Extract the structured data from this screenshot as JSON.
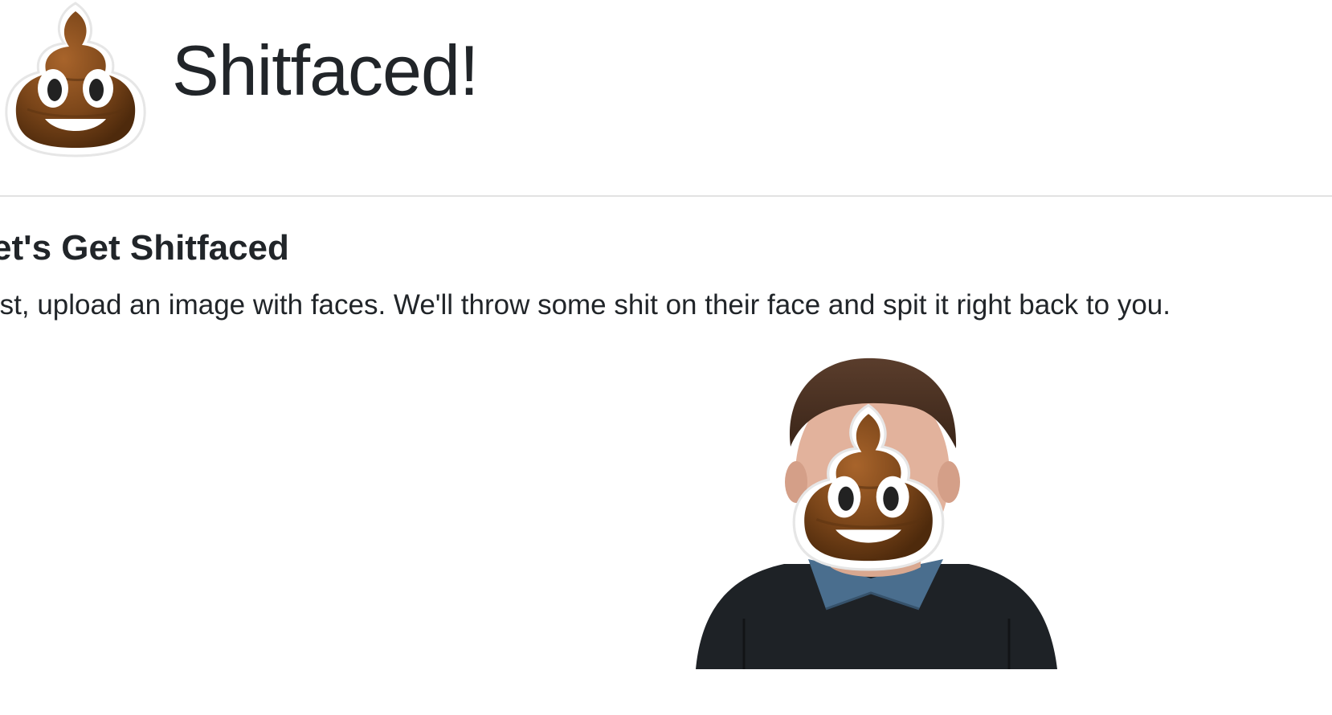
{
  "header": {
    "logo_icon": "pile-of-poo-icon",
    "title": "Shitfaced!"
  },
  "main": {
    "heading": "et's Get Shitfaced",
    "instructions": "rst, upload an image with faces. We'll throw some shit on their face and spit it right back to you."
  },
  "result_image": {
    "overlay_icon": "pile-of-poo-icon"
  },
  "colors": {
    "text": "#212529",
    "poo_brown": "#6b3d16",
    "divider": "#e2e2e2"
  }
}
